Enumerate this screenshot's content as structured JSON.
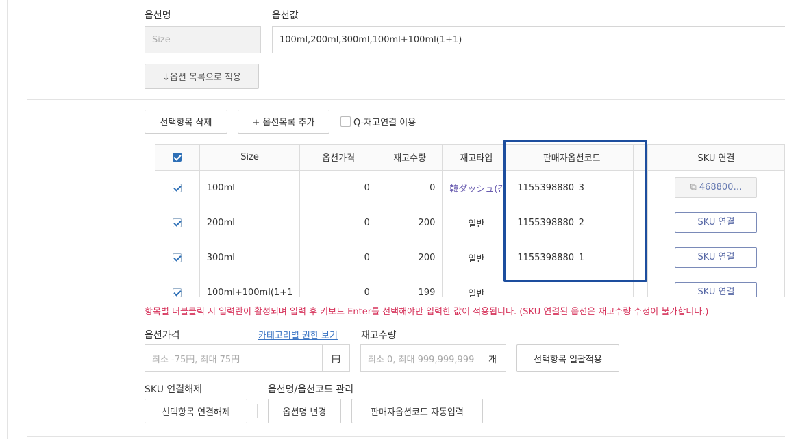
{
  "option_name_label": "옵션명",
  "option_value_label": "옵션값",
  "option_name_value": "Size",
  "option_values_input": "100ml,200ml,300ml,100ml+100ml(1+1)",
  "apply_to_list_button": "↓옵션 목록으로 적용",
  "delete_selected_button": "선택항목 삭제",
  "add_option_row_button": "+ 옵션목록 추가",
  "q_stock_checkbox_label": "Q-재고연결 이용",
  "table": {
    "headers": [
      "Size",
      "옵션가격",
      "재고수량",
      "재고타입",
      "판매자옵션코드",
      "SKU 연결"
    ],
    "rows": [
      {
        "size": "100ml",
        "price": "0",
        "stock": "0",
        "stock_type": "韓ダッシュ(간",
        "seller_code": "1155398880_3",
        "sku": "468800…",
        "sku_linked": true
      },
      {
        "size": "200ml",
        "price": "0",
        "stock": "200",
        "stock_type": "일반",
        "seller_code": "1155398880_2",
        "sku": "SKU 연결",
        "sku_linked": false
      },
      {
        "size": "300ml",
        "price": "0",
        "stock": "200",
        "stock_type": "일반",
        "seller_code": "1155398880_1",
        "sku": "SKU 연결",
        "sku_linked": false
      },
      {
        "size": "100ml+100ml(1+1",
        "price": "0",
        "stock": "199",
        "stock_type": "일반",
        "seller_code": "",
        "sku": "SKU 연결",
        "sku_linked": false
      }
    ]
  },
  "warning_text": "항목별 더블클릭 시 입력란이 활성되며 입력 후 키보드 Enter를 선택해야만 입력한 값이 적용됩니다. (SKU 연결된 옵션은 재고수량 수정이 불가합니다.)",
  "option_price_label": "옵션가격",
  "category_permission_link": "카테고리별 권한 보기",
  "stock_qty_label": "재고수량",
  "price_placeholder": "최소 -75円, 최대 75円",
  "price_unit": "円",
  "stock_placeholder": "최소 0, 최대 999,999,999",
  "stock_unit": "개",
  "bulk_apply_button": "선택항목 일괄적용",
  "sku_unlink_label": "SKU 연결해제",
  "option_manage_label": "옵션명/옵션코드 관리",
  "unlink_selected_button": "선택항목 연결해제",
  "rename_option_button": "옵션명 변경",
  "auto_seller_code_button": "판매자옵션코드 자동입력",
  "colors": {
    "accent": "#2d6fb6",
    "highlight_border": "#1d4e9e",
    "warning": "#d6335b",
    "link": "#3a74c4"
  }
}
